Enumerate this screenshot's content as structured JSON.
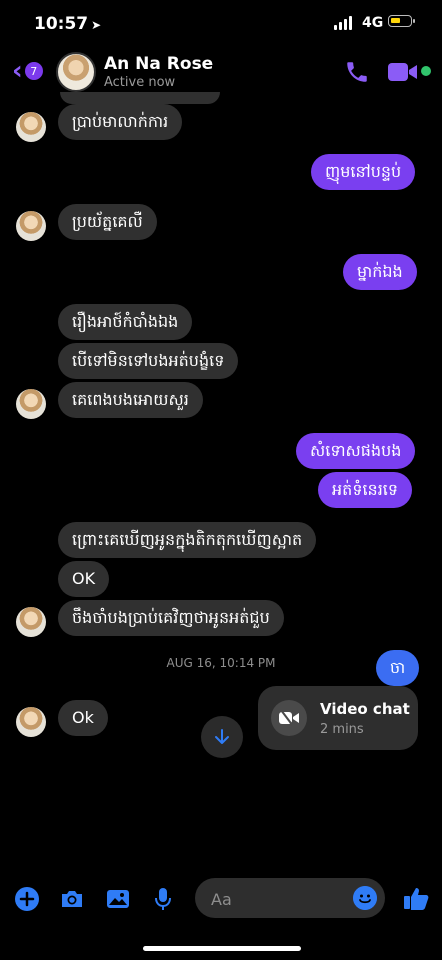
{
  "status_bar": {
    "time": "10:57",
    "network": "4G"
  },
  "header": {
    "back_count": "7",
    "contact_name": "An Na Rose",
    "contact_status": "Active now",
    "icons": [
      "chevron-left-icon",
      "phone-icon",
      "video-camera-icon"
    ]
  },
  "messages": [
    {
      "from": "them",
      "text": "ប្រាប់មាលាក់ការ"
    },
    {
      "from": "me",
      "text": "ញុមនៅបន្ទប់"
    },
    {
      "from": "them",
      "text": "ប្រយ័ត្នគេលឺ"
    },
    {
      "from": "me",
      "text": "ម្នាក់ឯង"
    },
    {
      "from": "them",
      "text": "រឿងអាថ៍កំបាំងឯង"
    },
    {
      "from": "them",
      "text": "បើទៅមិនទៅបងអត់បង្ខំទេ"
    },
    {
      "from": "them",
      "text": "គេពេងបងអោយសួរ"
    },
    {
      "from": "me",
      "text": "សំទោសផងបង"
    },
    {
      "from": "me",
      "text": "អត់ទំនេរទេ"
    },
    {
      "from": "them",
      "text": "ព្រោះគេឃើញអូនក្នុងតិកតុកឃើញស្អាត"
    },
    {
      "from": "them",
      "text": "OK"
    },
    {
      "from": "them",
      "text": "ចឹងចាំបងប្រាប់គេវិញថាអូនអត់ជួប"
    },
    {
      "from": "me",
      "text": "ចា"
    },
    {
      "from": "them",
      "text": "Ok"
    }
  ],
  "timestamp": "AUG 16, 10:14 PM",
  "call_card": {
    "title": "Video chat",
    "subtitle": "2 mins"
  },
  "composer": {
    "placeholder": "Aa"
  },
  "colors": {
    "accent": "#7a3ff0",
    "blue": "#2f7cf6",
    "incoming": "#303030",
    "background": "#000000"
  }
}
